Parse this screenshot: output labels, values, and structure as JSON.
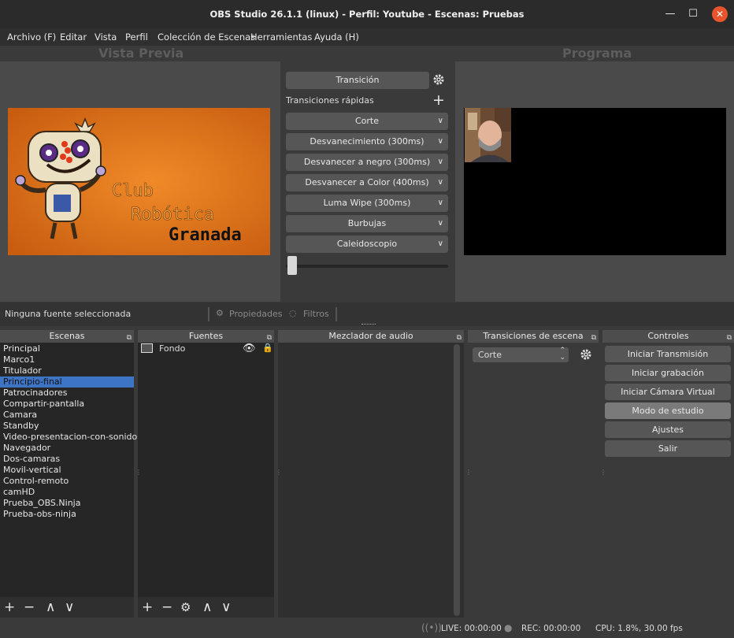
{
  "window": {
    "title": "OBS Studio 26.1.1 (linux) - Perfil: Youtube - Escenas: Pruebas",
    "min_glyph": "—",
    "max_glyph": "☐",
    "close_glyph": "✕"
  },
  "menu": [
    "Archivo (F)",
    "Editar",
    "Vista",
    "Perfil",
    "Colección de Escenas",
    "Herramientas",
    "Ayuda (H)"
  ],
  "preview": {
    "left_label": "Vista Previa",
    "right_label": "Programa",
    "logo_lines": [
      "Club",
      "Robótica",
      "Granada"
    ]
  },
  "transition_panel": {
    "transition_button": "Transición",
    "quick_label": "Transiciones rápidas",
    "quick_items": [
      "Corte",
      "Desvanecimiento (300ms)",
      "Desvanecer a negro (300ms)",
      "Desvanecer a Color (400ms)",
      "Luma Wipe (300ms)",
      "Burbujas",
      "Caleidoscopio"
    ]
  },
  "source_bar": {
    "selected_text": "Ninguna fuente seleccionada",
    "properties": "Propiedades",
    "filters": "Filtros"
  },
  "docks": {
    "scenes_title": "Escenas",
    "sources_title": "Fuentes",
    "mixer_title": "Mezclador de audio",
    "transitions_title": "Transiciones de escena",
    "controls_title": "Controles"
  },
  "scenes": [
    "Principal",
    "Marco1",
    "Titulador",
    "Principio-final",
    "Patrocinadores",
    "Compartir-pantalla",
    "Camara",
    "Standby",
    "Video-presentacion-con-sonido",
    "Navegador",
    "Dos-camaras",
    "Movil-vertical",
    "Control-remoto",
    "camHD",
    "Prueba_OBS.Ninja",
    "Prueba-obs-ninja"
  ],
  "selected_scene_index": 3,
  "sources": [
    {
      "name": "Fondo",
      "visible": true,
      "locked": true
    }
  ],
  "scene_transition": {
    "selected": "Corte"
  },
  "controls": [
    "Iniciar Transmisión",
    "Iniciar grabación",
    "Iniciar Cámara Virtual",
    "Modo de estudio",
    "Ajustes",
    "Salir"
  ],
  "active_control_index": 3,
  "status": {
    "live": "LIVE: 00:00:00",
    "rec": "REC: 00:00:00",
    "cpu": "CPU: 1.8%, 30.00 fps"
  },
  "colors": {
    "accent": "#3d75c4",
    "logo_bg": "#e5761a",
    "close": "#e9542c"
  }
}
